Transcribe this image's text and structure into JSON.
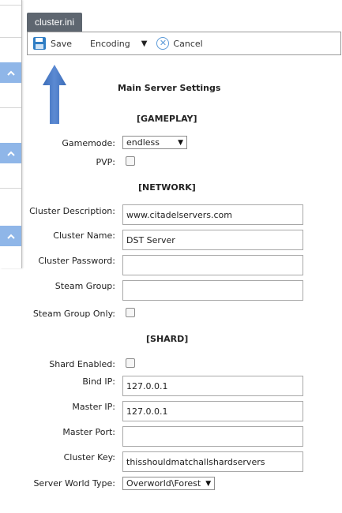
{
  "tab": {
    "title": "cluster.ini"
  },
  "toolbar": {
    "save_label": "Save",
    "encoding_label": "Encoding",
    "cancel_label": "Cancel"
  },
  "left_panel": {
    "collapse_glyph": "^"
  },
  "form": {
    "title": "Main Server Settings",
    "gameplay": {
      "heading": "[GAMEPLAY]",
      "gamemode_label": "Gamemode:",
      "gamemode_value": "endless",
      "pvp_label": "PVP:",
      "pvp_checked": false
    },
    "network": {
      "heading": "[NETWORK]",
      "description_label": "Cluster Description:",
      "description_value": "www.citadelservers.com",
      "name_label": "Cluster Name:",
      "name_value": "DST Server",
      "password_label": "Cluster Password:",
      "password_value": "",
      "steam_group_label": "Steam Group:",
      "steam_group_value": "",
      "steam_group_only_label": "Steam Group Only:",
      "steam_group_only_checked": false
    },
    "shard": {
      "heading": "[SHARD]",
      "shard_enabled_label": "Shard Enabled:",
      "shard_enabled_checked": false,
      "bind_ip_label": "Bind IP:",
      "bind_ip_value": "127.0.0.1",
      "master_ip_label": "Master IP:",
      "master_ip_value": "127.0.0.1",
      "master_port_label": "Master Port:",
      "master_port_value": "",
      "cluster_key_label": "Cluster Key:",
      "cluster_key_value": "thisshouldmatchallshardservers",
      "world_type_label": "Server World Type:",
      "world_type_value": "Overworld\\Forest"
    }
  },
  "colors": {
    "tab_bg": "#5e6670",
    "accent_blue": "#2f7dc4",
    "collapse_bg": "#8fb6e8",
    "arrow_blue": "#4a7cc6"
  },
  "icons": [
    "floppy-disk-icon",
    "chevron-down-icon",
    "cancel-circle-icon",
    "chevron-up-icon",
    "up-arrow-annotation"
  ]
}
